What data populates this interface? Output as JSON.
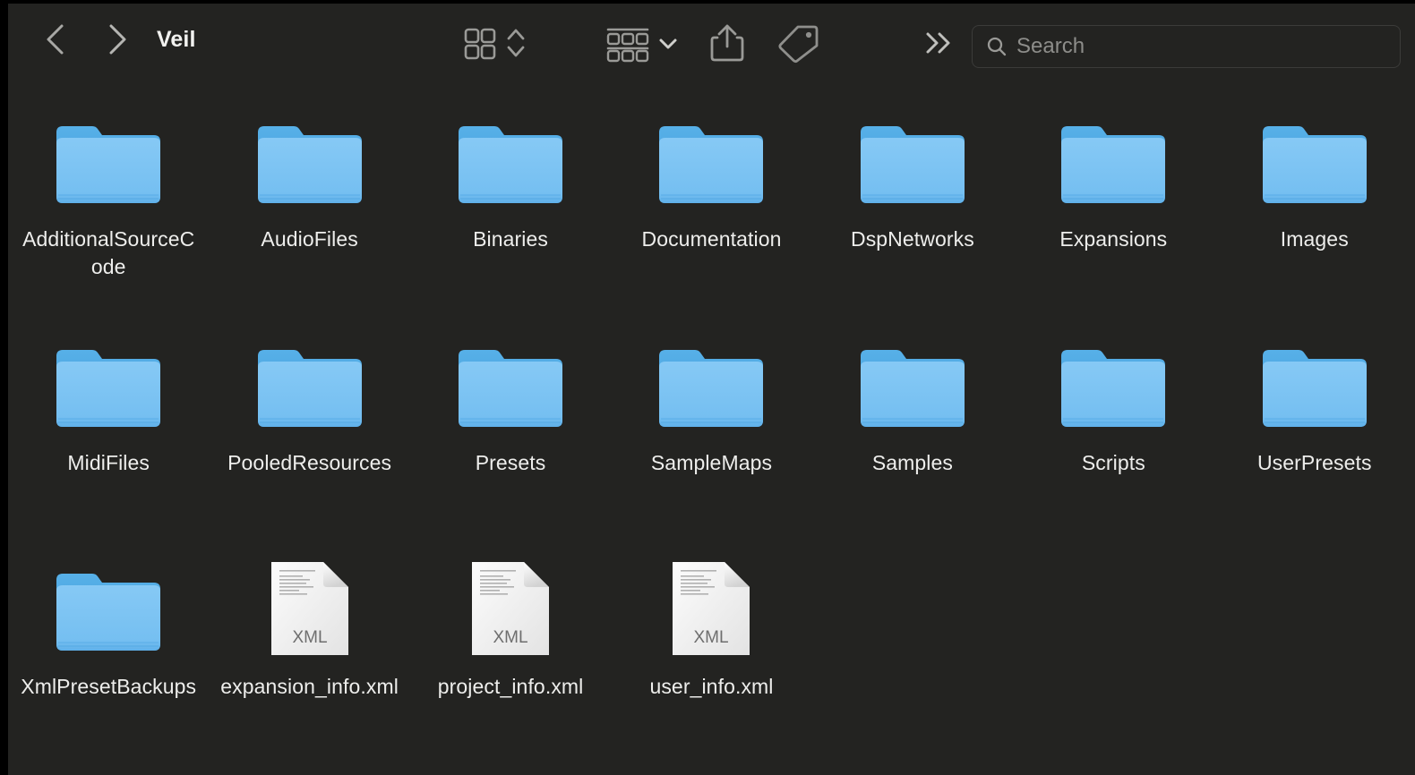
{
  "window": {
    "background_color": "#232321",
    "title": "Veil"
  },
  "toolbar": {
    "back_label": "Back",
    "forward_label": "Forward",
    "title": "Veil",
    "view_grid_label": "Icon View",
    "view_sort_label": "Sort Order",
    "group_by_label": "Group By",
    "group_chevron_label": "Group Options",
    "share_label": "Share",
    "tags_label": "Tags",
    "overflow_label": "More Toolbar Items",
    "icons": {
      "back": "chevron-left-icon",
      "forward": "chevron-right-icon",
      "view_grid": "grid-view-icon",
      "view_sort": "chevron-up-down-icon",
      "group_by": "group-rows-icon",
      "group_chevron": "chevron-down-icon",
      "share": "share-icon",
      "tags": "tag-icon",
      "overflow": "double-chevron-right-icon",
      "search": "search-icon"
    }
  },
  "search": {
    "placeholder": "Search",
    "value": ""
  },
  "colors": {
    "folder_front": "#7cc4f2",
    "folder_back": "#4fa8e0",
    "document_page": "#f4f4f4",
    "label_text": "#eeeeec",
    "toolbar_icon": "#9a9a97",
    "accent_title": "#f2f2f0"
  },
  "file_grid": {
    "items": [
      {
        "name": "AdditionalSourceCode",
        "type": "folder",
        "icon": "folder-icon"
      },
      {
        "name": "AudioFiles",
        "type": "folder",
        "icon": "folder-icon"
      },
      {
        "name": "Binaries",
        "type": "folder",
        "icon": "folder-icon"
      },
      {
        "name": "Documentation",
        "type": "folder",
        "icon": "folder-icon"
      },
      {
        "name": "DspNetworks",
        "type": "folder",
        "icon": "folder-icon"
      },
      {
        "name": "Expansions",
        "type": "folder",
        "icon": "folder-icon"
      },
      {
        "name": "Images",
        "type": "folder",
        "icon": "folder-icon"
      },
      {
        "name": "MidiFiles",
        "type": "folder",
        "icon": "folder-icon"
      },
      {
        "name": "PooledResources",
        "type": "folder",
        "icon": "folder-icon"
      },
      {
        "name": "Presets",
        "type": "folder",
        "icon": "folder-icon"
      },
      {
        "name": "SampleMaps",
        "type": "folder",
        "icon": "folder-icon"
      },
      {
        "name": "Samples",
        "type": "folder",
        "icon": "folder-icon"
      },
      {
        "name": "Scripts",
        "type": "folder",
        "icon": "folder-icon"
      },
      {
        "name": "UserPresets",
        "type": "folder",
        "icon": "folder-icon"
      },
      {
        "name": "XmlPresetBackups",
        "type": "folder",
        "icon": "folder-icon"
      },
      {
        "name": "expansion_info.xml",
        "type": "document",
        "icon": "xml-document-icon",
        "badge": "XML"
      },
      {
        "name": "project_info.xml",
        "type": "document",
        "icon": "xml-document-icon",
        "badge": "XML"
      },
      {
        "name": "user_info.xml",
        "type": "document",
        "icon": "xml-document-icon",
        "badge": "XML"
      }
    ]
  }
}
